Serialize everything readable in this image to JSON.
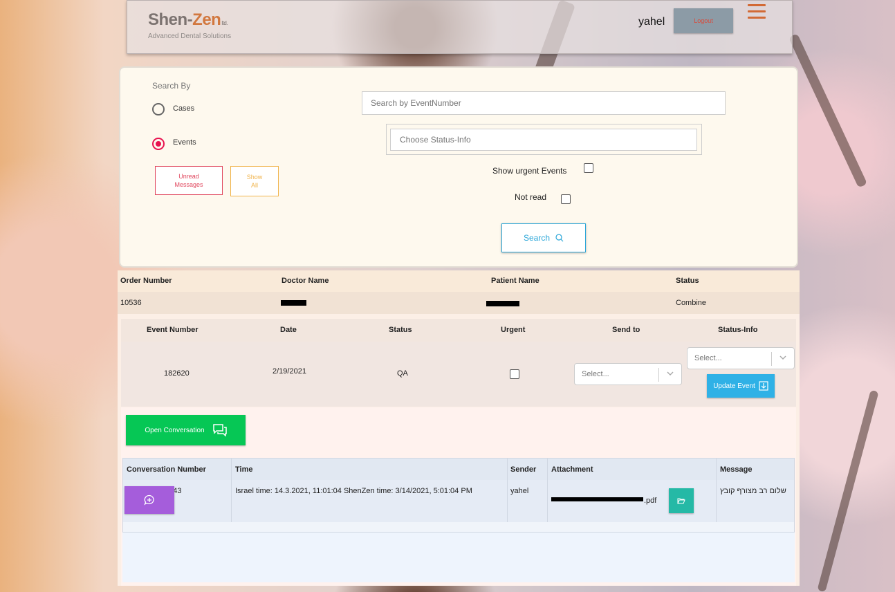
{
  "header": {
    "logo_name_a": "Shen-",
    "logo_name_z": "Zen",
    "logo_ltd": "ltd.",
    "logo_tagline": "Advanced Dental Solutions",
    "username": "yahel",
    "logout_label": "Logout"
  },
  "search": {
    "search_by_label": "Search By",
    "radio_cases": "Cases",
    "radio_events": "Events",
    "selected_mode": "Events",
    "unread_messages_label": "Unread Messages",
    "show_all_label": "Show All",
    "event_number_placeholder": "Search by EventNumber",
    "status_info_placeholder": "Choose Status-Info",
    "show_urgent_label": "Show urgent Events",
    "not_read_label": "Not read",
    "search_button_label": "Search"
  },
  "orders": {
    "columns": [
      "Order Number",
      "Doctor Name",
      "Patient Name",
      "Status"
    ],
    "rows": [
      {
        "order_number": "10536",
        "status": "Combine"
      }
    ]
  },
  "events": {
    "columns": [
      "Event Number",
      "Date",
      "Status",
      "Urgent",
      "Send to",
      "Status-Info"
    ],
    "rows": [
      {
        "event_number": "182620",
        "date": "2/19/2021",
        "status": "QA",
        "urgent": false,
        "send_to_placeholder": "Select...",
        "status_info_placeholder": "Select...",
        "update_label": "Update Event"
      }
    ],
    "open_conversation_label": "Open Conversation"
  },
  "conversations": {
    "columns": [
      "Conversation Number",
      "Time",
      "Sender",
      "Attachment",
      "Message"
    ],
    "rows": [
      {
        "number": "1615712464843",
        "time": "Israel time: 14.3.2021, 11:01:04 ShenZen time: 3/14/2021, 5:01:04 PM",
        "sender": "yahel",
        "attachment_ext": ".pdf",
        "message": "שלום רב מצורף קובץ"
      }
    ]
  },
  "icons": {
    "menu": "hamburger-icon",
    "search": "magnifier-icon",
    "update": "download-icon",
    "conversation": "chat-bubbles-icon",
    "attachment": "folder-open-icon",
    "add_message": "add-comment-icon"
  },
  "colors": {
    "accent_red": "#e8124f",
    "search_blue": "#2aa6d8",
    "update_blue": "#2fb1e6",
    "conversation_green": "#06c755",
    "attach_teal": "#25b9a6",
    "add_purple": "#a55ddb",
    "logo_orange": "#d2783f"
  }
}
